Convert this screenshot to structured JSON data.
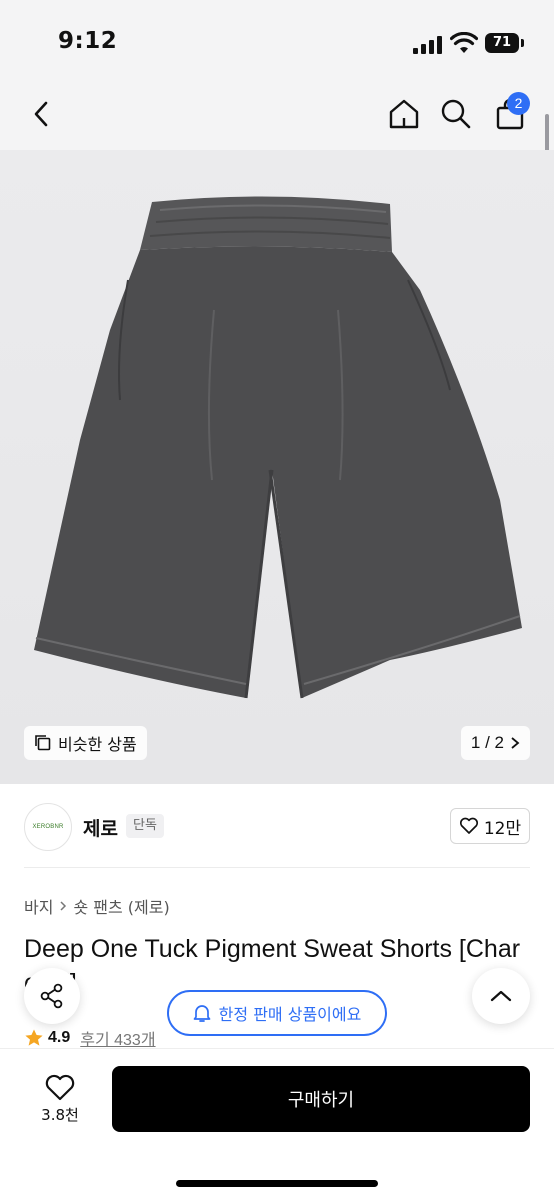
{
  "status_bar": {
    "time": "9:12",
    "battery": "71",
    "icons": [
      "signal-icon",
      "wifi-icon",
      "battery-icon"
    ]
  },
  "nav": {
    "icons": [
      "back-chevron-icon",
      "home-icon",
      "search-icon",
      "cart-icon"
    ],
    "cart_count": "2"
  },
  "gallery": {
    "similar_label": "비슷한 상품",
    "pager": "1 / 2"
  },
  "brand": {
    "logo_text": "XEROBNR",
    "name": "제로",
    "tag": "단독",
    "likes": "12만"
  },
  "breadcrumb": [
    "바지",
    "숏 팬츠 (제로)"
  ],
  "product": {
    "title": "Deep One Tuck Pigment Sweat Shorts [Charcoal]",
    "rating": "4.9",
    "reviews": "후기 433개"
  },
  "floating": {
    "limited_label": "한정 판매 상품이에요"
  },
  "bottom": {
    "wish_count": "3.8천",
    "buy_label": "구매하기"
  },
  "colors": {
    "accent": "#2e6ef5",
    "star": "#f5a623",
    "shorts": "#4d4d4f"
  }
}
